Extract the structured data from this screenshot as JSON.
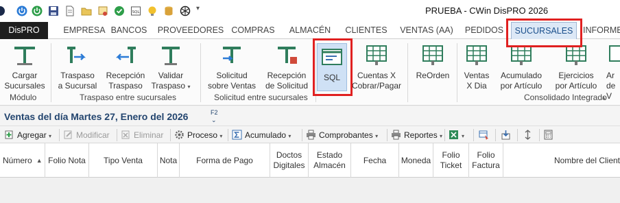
{
  "window": {
    "title": "PRUEBA - CWin DisPRO 2026"
  },
  "tabs": [
    {
      "label": "DisPRO"
    },
    {
      "label": "EMPRESA"
    },
    {
      "label": "BANCOS"
    },
    {
      "label": "PROVEEDORES"
    },
    {
      "label": "COMPRAS"
    },
    {
      "label": "ALMACÉN"
    },
    {
      "label": "CLIENTES"
    },
    {
      "label": "VENTAS (AA)"
    },
    {
      "label": "PEDIDOS"
    },
    {
      "label": "SUCURSALES"
    },
    {
      "label": "INFORME"
    }
  ],
  "ribbon": {
    "buttons": [
      {
        "line1": "Cargar",
        "line2": "Sucursales"
      },
      {
        "line1": "Traspaso",
        "line2": "a Sucursal"
      },
      {
        "line1": "Recepción",
        "line2": "Traspaso"
      },
      {
        "line1": "Validar",
        "line2": "Traspaso"
      },
      {
        "line1": "Solicitud",
        "line2": "sobre Ventas"
      },
      {
        "line1": "Recepción",
        "line2": "de Solicitud"
      },
      {
        "line1": "SQL",
        "line2": ""
      },
      {
        "line1": "Cuentas X",
        "line2": "Cobrar/Pagar"
      },
      {
        "line1": "ReOrden",
        "line2": ""
      },
      {
        "line1": "Ventas",
        "line2": "X Dia"
      },
      {
        "line1": "Acumulado",
        "line2": "por Artículo"
      },
      {
        "line1": "Ejercicios",
        "line2": "por Artículo"
      },
      {
        "line1": "Ar",
        "line2": "de V"
      }
    ],
    "groups": {
      "modulo": "Módulo",
      "traspaso": "Traspaso entre sucursales",
      "solicitud": "Solicitud entre sucursales",
      "consolidado": "Consolidado Integrado"
    }
  },
  "section": {
    "title": "Ventas del día Martes 27, Enero del 2026",
    "hint": "F2"
  },
  "toolbar": {
    "agregar": "Agregar",
    "modificar": "Modificar",
    "eliminar": "Eliminar",
    "proceso": "Proceso",
    "acumulado": "Acumulado",
    "comprobantes": "Comprobantes",
    "reportes": "Reportes"
  },
  "grid": {
    "columns": [
      {
        "l1": "Número",
        "l2": ""
      },
      {
        "l1": "Folio Nota",
        "l2": ""
      },
      {
        "l1": "Tipo Venta",
        "l2": ""
      },
      {
        "l1": "Nota",
        "l2": ""
      },
      {
        "l1": "Forma de Pago",
        "l2": ""
      },
      {
        "l1": "Doctos",
        "l2": "Digitales"
      },
      {
        "l1": "Estado",
        "l2": "Almacén"
      },
      {
        "l1": "Fecha",
        "l2": ""
      },
      {
        "l1": "Moneda",
        "l2": ""
      },
      {
        "l1": "Folio",
        "l2": "Ticket"
      },
      {
        "l1": "Folio",
        "l2": "Factura"
      },
      {
        "l1": "Nombre del Client",
        "l2": ""
      }
    ]
  },
  "colors": {
    "accent": "#1a4f8c",
    "highlight": "#e02020",
    "ribbon_icon": "#2f7d5c"
  }
}
